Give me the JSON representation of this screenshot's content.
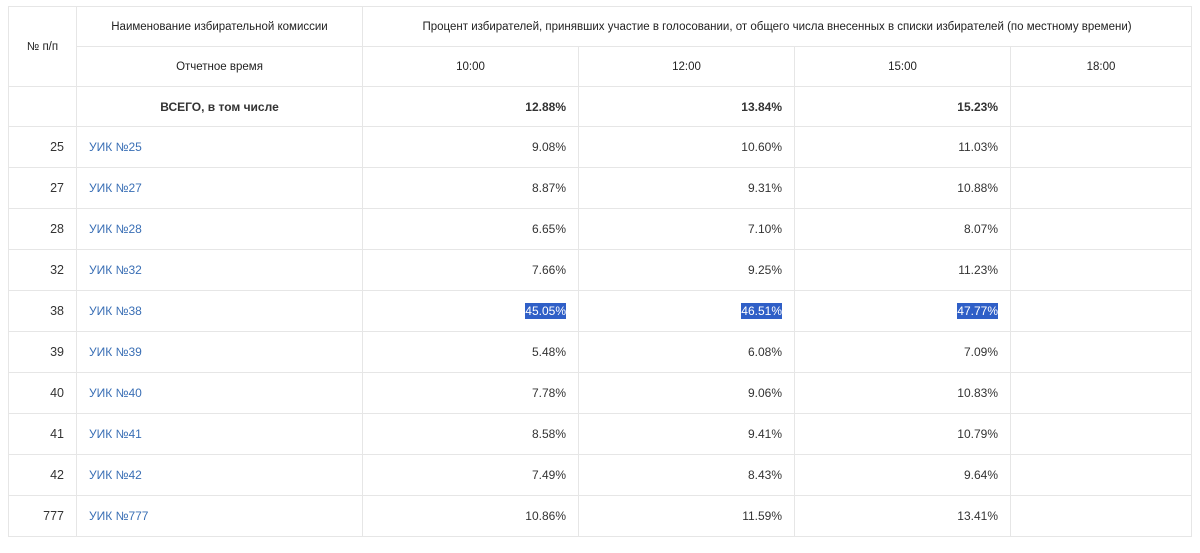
{
  "header": {
    "num_label": "№ п/п",
    "name_label": "Наименование избирательной комиссии",
    "percent_label": "Процент избирателей, принявших участие в голосовании, от общего числа внесенных в списки избирателей (по местному времени)",
    "report_time_label": "Отчетное время",
    "times": [
      "10:00",
      "12:00",
      "15:00",
      "18:00"
    ]
  },
  "total": {
    "label": "ВСЕГО, в том числе",
    "values": [
      "12.88%",
      "13.84%",
      "15.23%",
      ""
    ]
  },
  "rows": [
    {
      "num": "25",
      "name": "УИК №25",
      "values": [
        "9.08%",
        "10.60%",
        "11.03%",
        ""
      ]
    },
    {
      "num": "27",
      "name": "УИК №27",
      "values": [
        "8.87%",
        "9.31%",
        "10.88%",
        ""
      ]
    },
    {
      "num": "28",
      "name": "УИК №28",
      "values": [
        "6.65%",
        "7.10%",
        "8.07%",
        ""
      ]
    },
    {
      "num": "32",
      "name": "УИК №32",
      "values": [
        "7.66%",
        "9.25%",
        "11.23%",
        ""
      ]
    },
    {
      "num": "38",
      "name": "УИК №38",
      "values": [
        "45.05%",
        "46.51%",
        "47.77%",
        ""
      ],
      "selected": true
    },
    {
      "num": "39",
      "name": "УИК №39",
      "values": [
        "5.48%",
        "6.08%",
        "7.09%",
        ""
      ]
    },
    {
      "num": "40",
      "name": "УИК №40",
      "values": [
        "7.78%",
        "9.06%",
        "10.83%",
        ""
      ]
    },
    {
      "num": "41",
      "name": "УИК №41",
      "values": [
        "8.58%",
        "9.41%",
        "10.79%",
        ""
      ]
    },
    {
      "num": "42",
      "name": "УИК №42",
      "values": [
        "7.49%",
        "8.43%",
        "9.64%",
        ""
      ]
    },
    {
      "num": "777",
      "name": "УИК №777",
      "values": [
        "10.86%",
        "11.59%",
        "13.41%",
        ""
      ]
    }
  ],
  "colors": {
    "link": "#3a6fb5",
    "selection": "#2f5fc7",
    "border": "#e6e6e6"
  }
}
